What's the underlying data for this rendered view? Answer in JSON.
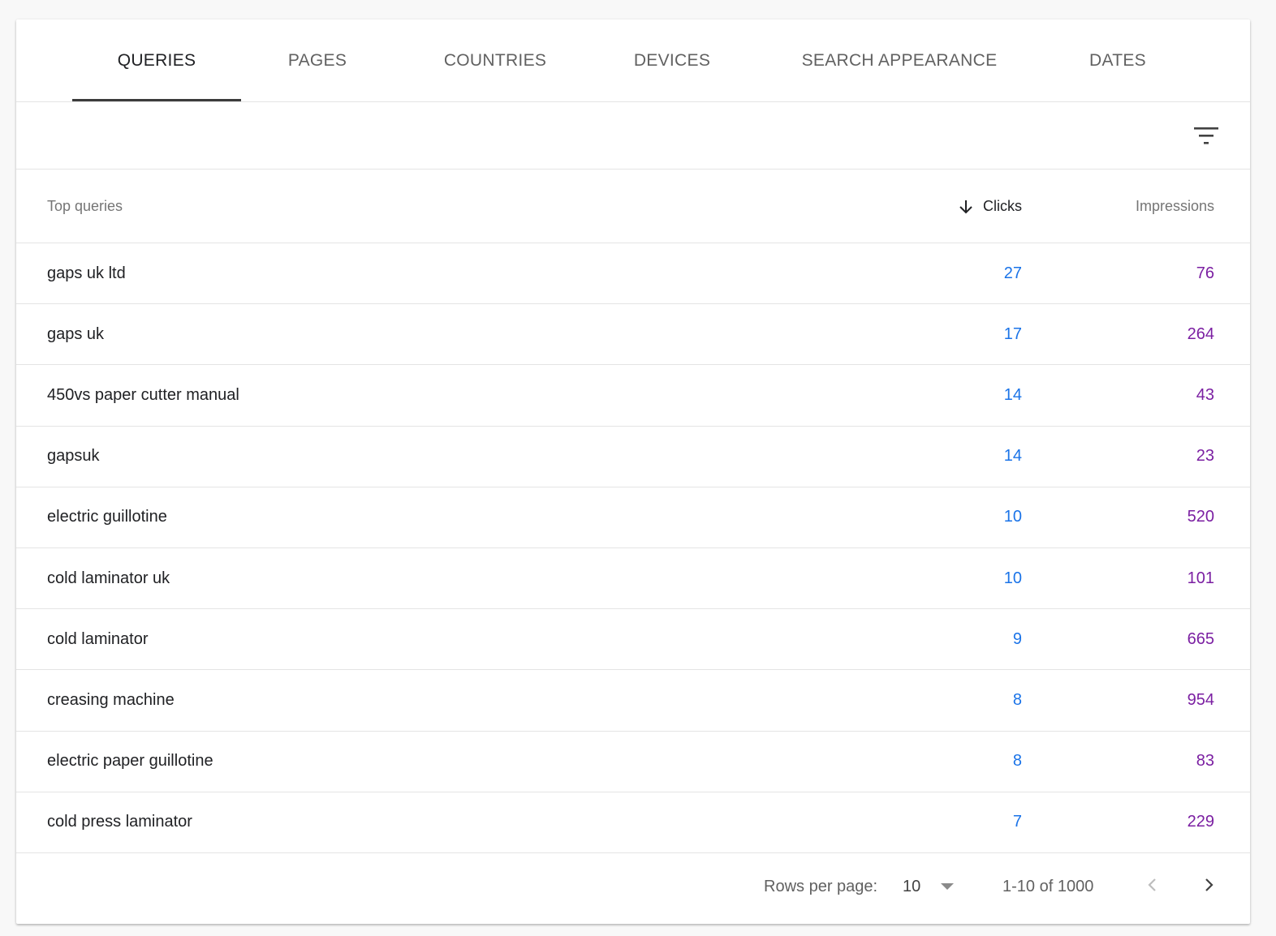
{
  "tabs": [
    {
      "label": "QUERIES",
      "active": true
    },
    {
      "label": "PAGES",
      "active": false
    },
    {
      "label": "COUNTRIES",
      "active": false
    },
    {
      "label": "DEVICES",
      "active": false
    },
    {
      "label": "SEARCH APPEARANCE",
      "active": false
    },
    {
      "label": "DATES",
      "active": false
    }
  ],
  "filter": {
    "icon": "filter-list-icon"
  },
  "table": {
    "headers": {
      "query": "Top queries",
      "clicks": "Clicks",
      "impressions": "Impressions",
      "sort_icon": "arrow-down-icon"
    },
    "rows": [
      {
        "query": "gaps uk ltd",
        "clicks": "27",
        "impressions": "76"
      },
      {
        "query": "gaps uk",
        "clicks": "17",
        "impressions": "264"
      },
      {
        "query": "450vs paper cutter manual",
        "clicks": "14",
        "impressions": "43"
      },
      {
        "query": "gapsuk",
        "clicks": "14",
        "impressions": "23"
      },
      {
        "query": "electric guillotine",
        "clicks": "10",
        "impressions": "520"
      },
      {
        "query": "cold laminator uk",
        "clicks": "10",
        "impressions": "101"
      },
      {
        "query": "cold laminator",
        "clicks": "9",
        "impressions": "665"
      },
      {
        "query": "creasing machine",
        "clicks": "8",
        "impressions": "954"
      },
      {
        "query": "electric paper guillotine",
        "clicks": "8",
        "impressions": "83"
      },
      {
        "query": "cold press laminator",
        "clicks": "7",
        "impressions": "229"
      }
    ]
  },
  "footer": {
    "rows_per_page_label": "Rows per page:",
    "rows_per_page_value": "10",
    "range": "1-10 of 1000",
    "prev_icon": "chevron-left-icon",
    "next_icon": "chevron-right-icon"
  },
  "colors": {
    "clicks": "#1a73e8",
    "impressions": "#7b1fa2",
    "tab_indicator": "#3c3c3c"
  }
}
